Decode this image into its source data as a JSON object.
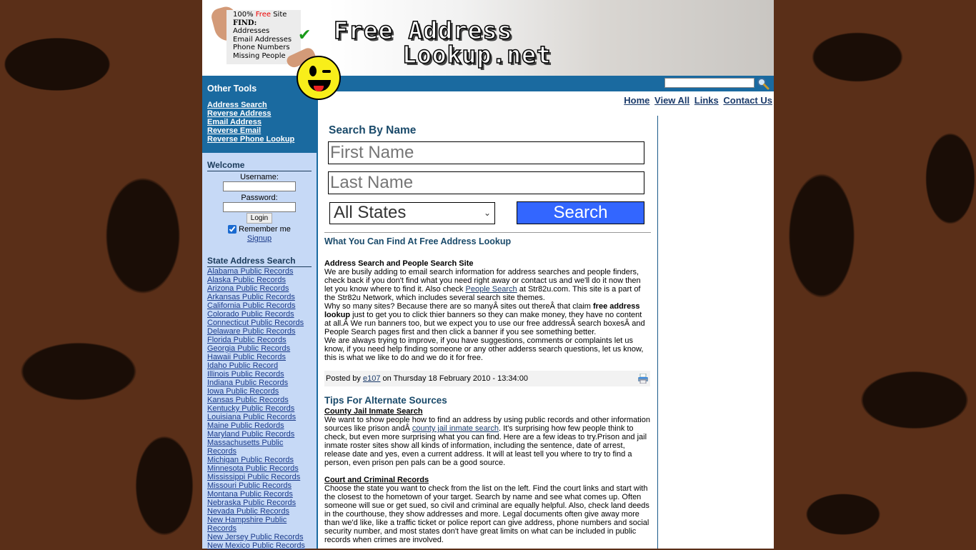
{
  "header": {
    "promo": {
      "line1_prefix": "100% ",
      "line1_free": "Free",
      "line1_suffix": " Site",
      "find_label": "FIND:",
      "items": [
        "Addresses",
        "Email Addresses",
        "Phone Numbers",
        "Missing People"
      ]
    },
    "logo_line1": "Free Address",
    "logo_line2": "Lookup.net"
  },
  "site_search": {
    "value": "",
    "placeholder": ""
  },
  "top_nav": [
    "Home",
    "View All",
    "Links",
    "Contact Us"
  ],
  "sidebar": {
    "other_tools": {
      "title": "Other Tools",
      "links": [
        "Address Search",
        "Reverse Address",
        "Email Address",
        "Reverse Email",
        "Reverse Phone Lookup"
      ]
    },
    "welcome": {
      "title": "Welcome",
      "username_label": "Username:",
      "username_value": "",
      "password_label": "Password:",
      "password_value": "",
      "login_label": "Login",
      "remember_label": "Remember me",
      "remember_checked": true,
      "signup_label": "Signup"
    },
    "states": {
      "title": "State Address Search",
      "links": [
        "Alabama Public Records",
        "Alaska Public Records",
        "Arizona Public Records",
        "Arkansas Public Records",
        "California Public Records",
        "Colorado Public Records",
        "Connecticut Public Records",
        "Delaware Public Records",
        "Florida Public Records",
        "Georgia Public Records",
        "Hawaii Public Records",
        "Idaho Public Record",
        "Illinois Public Records",
        "Indiana Public Records",
        "Iowa Public Records",
        "Kansas Public Records",
        "Kentucky Public Records",
        "Louisiana Public Records",
        "Maine Public Redords",
        "Maryland Public Records",
        "Massachusetts Public Records",
        "Michigan Public Records",
        "Minnesota Public Records",
        "Mississippi Public Records",
        "Missouri Public Records",
        "Montana Public Records",
        "Nebraska Public Records",
        "Nevada Public Records",
        "New Hampshire Public Records",
        "New Jersey Public Records",
        "New Mexico Public Records"
      ]
    }
  },
  "search_form": {
    "title": "Search By Name",
    "first_name_placeholder": "First Name",
    "last_name_placeholder": "Last Name",
    "state_selected": "All States",
    "search_label": "Search"
  },
  "article": {
    "section_title": "What You Can Find At Free Address Lookup",
    "heading": "Address Search and People Search Site",
    "p1_before_link": "We are busily adding to email search information for address searches and people finders, check back if you don't find what you need right away or contact us and we'll do it now then let you know where to find it. Also check ",
    "p1_link": "People Search",
    "p1_after_link": " at Str82u.com. This site is a part of the Str82u Network, which includes several search site themes.",
    "p2_before_bold": "Why so many sites? Because there are so manyÂ sites out thereÂ that claim ",
    "p2_bold": "free address lookup",
    "p2_after_bold": " just to get you to click thier banners so they can make money, they have no content at all.Â  We run banners too, but we expect you to use our free addressÂ search boxesÂ and People Search pages first and then click a banner if you see something better.",
    "p3": "We are always trying to improve, if you have suggestions, comments or complaints let us know, if you need help finding someone or any other adderss search questions, let us know, this is what we like to do and we do it for free.",
    "posted_prefix": "Posted by ",
    "posted_author": "e107",
    "posted_suffix": " on Thursday 18 February 2010 - 13:34:00"
  },
  "tips": {
    "title": "Tips For Alternate Sources",
    "s1_heading": "County Jail Inmate Search",
    "s1_before_link": "We want to show people how to find an address by using public records and other information sources like prison andÂ ",
    "s1_link": "county jail inmate search",
    "s1_after_link": ". It's surprising how few people think to check, but even more surprising what you can find. Here are a few ideas to try.Prison and jail inmate roster sites show all kinds of information, including the sentence, date of arrest, release date and yes, even a current address. It will at least tell you where to try to find a person, even prison pen pals can be a good source.",
    "s2_heading": "Court and Criminal Records",
    "s2_text": "Choose the state you want to check from the list on the left. Find the court links and start with the closest to the hometown of your target. Search by name and see what comes up. Often someone will sue or get sued, so civil and criminal are equally helpful. Also, check land deeds in the courthouse, they show addresses and more. Legal documents often give away more than we'd like, like a traffic ticket or police report can give address, phone numbers and social security number, and most states don't have great limits on what can be included in public records when crimes are involved."
  },
  "colors": {
    "brand_blue": "#1a6aa0",
    "sidebar_bg": "#c6d9f6",
    "search_button": "#3366ff",
    "heading_blue": "#1a4a6a",
    "free_red": "#ee0000"
  }
}
